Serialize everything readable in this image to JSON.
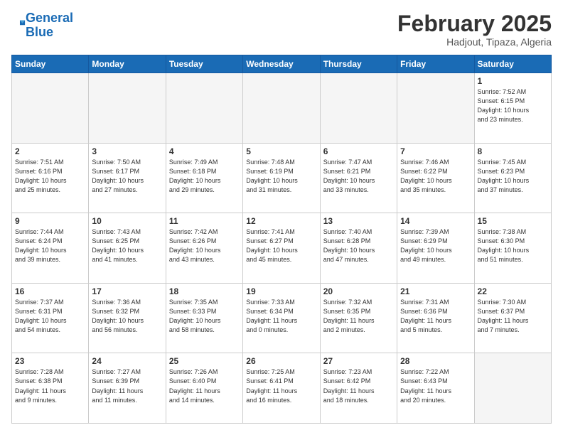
{
  "header": {
    "logo_line1": "General",
    "logo_line2": "Blue",
    "month": "February 2025",
    "location": "Hadjout, Tipaza, Algeria"
  },
  "days_of_week": [
    "Sunday",
    "Monday",
    "Tuesday",
    "Wednesday",
    "Thursday",
    "Friday",
    "Saturday"
  ],
  "weeks": [
    [
      {
        "num": "",
        "info": ""
      },
      {
        "num": "",
        "info": ""
      },
      {
        "num": "",
        "info": ""
      },
      {
        "num": "",
        "info": ""
      },
      {
        "num": "",
        "info": ""
      },
      {
        "num": "",
        "info": ""
      },
      {
        "num": "1",
        "info": "Sunrise: 7:52 AM\nSunset: 6:15 PM\nDaylight: 10 hours\nand 23 minutes."
      }
    ],
    [
      {
        "num": "2",
        "info": "Sunrise: 7:51 AM\nSunset: 6:16 PM\nDaylight: 10 hours\nand 25 minutes."
      },
      {
        "num": "3",
        "info": "Sunrise: 7:50 AM\nSunset: 6:17 PM\nDaylight: 10 hours\nand 27 minutes."
      },
      {
        "num": "4",
        "info": "Sunrise: 7:49 AM\nSunset: 6:18 PM\nDaylight: 10 hours\nand 29 minutes."
      },
      {
        "num": "5",
        "info": "Sunrise: 7:48 AM\nSunset: 6:19 PM\nDaylight: 10 hours\nand 31 minutes."
      },
      {
        "num": "6",
        "info": "Sunrise: 7:47 AM\nSunset: 6:21 PM\nDaylight: 10 hours\nand 33 minutes."
      },
      {
        "num": "7",
        "info": "Sunrise: 7:46 AM\nSunset: 6:22 PM\nDaylight: 10 hours\nand 35 minutes."
      },
      {
        "num": "8",
        "info": "Sunrise: 7:45 AM\nSunset: 6:23 PM\nDaylight: 10 hours\nand 37 minutes."
      }
    ],
    [
      {
        "num": "9",
        "info": "Sunrise: 7:44 AM\nSunset: 6:24 PM\nDaylight: 10 hours\nand 39 minutes."
      },
      {
        "num": "10",
        "info": "Sunrise: 7:43 AM\nSunset: 6:25 PM\nDaylight: 10 hours\nand 41 minutes."
      },
      {
        "num": "11",
        "info": "Sunrise: 7:42 AM\nSunset: 6:26 PM\nDaylight: 10 hours\nand 43 minutes."
      },
      {
        "num": "12",
        "info": "Sunrise: 7:41 AM\nSunset: 6:27 PM\nDaylight: 10 hours\nand 45 minutes."
      },
      {
        "num": "13",
        "info": "Sunrise: 7:40 AM\nSunset: 6:28 PM\nDaylight: 10 hours\nand 47 minutes."
      },
      {
        "num": "14",
        "info": "Sunrise: 7:39 AM\nSunset: 6:29 PM\nDaylight: 10 hours\nand 49 minutes."
      },
      {
        "num": "15",
        "info": "Sunrise: 7:38 AM\nSunset: 6:30 PM\nDaylight: 10 hours\nand 51 minutes."
      }
    ],
    [
      {
        "num": "16",
        "info": "Sunrise: 7:37 AM\nSunset: 6:31 PM\nDaylight: 10 hours\nand 54 minutes."
      },
      {
        "num": "17",
        "info": "Sunrise: 7:36 AM\nSunset: 6:32 PM\nDaylight: 10 hours\nand 56 minutes."
      },
      {
        "num": "18",
        "info": "Sunrise: 7:35 AM\nSunset: 6:33 PM\nDaylight: 10 hours\nand 58 minutes."
      },
      {
        "num": "19",
        "info": "Sunrise: 7:33 AM\nSunset: 6:34 PM\nDaylight: 11 hours\nand 0 minutes."
      },
      {
        "num": "20",
        "info": "Sunrise: 7:32 AM\nSunset: 6:35 PM\nDaylight: 11 hours\nand 2 minutes."
      },
      {
        "num": "21",
        "info": "Sunrise: 7:31 AM\nSunset: 6:36 PM\nDaylight: 11 hours\nand 5 minutes."
      },
      {
        "num": "22",
        "info": "Sunrise: 7:30 AM\nSunset: 6:37 PM\nDaylight: 11 hours\nand 7 minutes."
      }
    ],
    [
      {
        "num": "23",
        "info": "Sunrise: 7:28 AM\nSunset: 6:38 PM\nDaylight: 11 hours\nand 9 minutes."
      },
      {
        "num": "24",
        "info": "Sunrise: 7:27 AM\nSunset: 6:39 PM\nDaylight: 11 hours\nand 11 minutes."
      },
      {
        "num": "25",
        "info": "Sunrise: 7:26 AM\nSunset: 6:40 PM\nDaylight: 11 hours\nand 14 minutes."
      },
      {
        "num": "26",
        "info": "Sunrise: 7:25 AM\nSunset: 6:41 PM\nDaylight: 11 hours\nand 16 minutes."
      },
      {
        "num": "27",
        "info": "Sunrise: 7:23 AM\nSunset: 6:42 PM\nDaylight: 11 hours\nand 18 minutes."
      },
      {
        "num": "28",
        "info": "Sunrise: 7:22 AM\nSunset: 6:43 PM\nDaylight: 11 hours\nand 20 minutes."
      },
      {
        "num": "",
        "info": ""
      }
    ]
  ]
}
